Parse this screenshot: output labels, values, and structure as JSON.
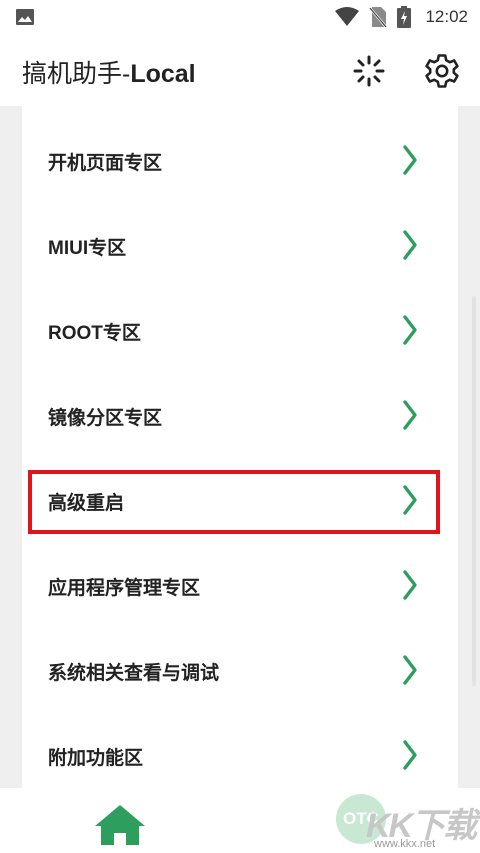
{
  "status_bar": {
    "time": "12:02",
    "icons": [
      "image-icon",
      "wifi-icon",
      "no-sim-icon",
      "battery-charging-icon"
    ]
  },
  "app_bar": {
    "title_cjk": "搞机助手-",
    "title_latin": "Local",
    "actions": [
      "loading-icon",
      "settings-icon"
    ]
  },
  "menu": {
    "items": [
      {
        "label": "开机页面专区"
      },
      {
        "label": "MIUI专区"
      },
      {
        "label": "ROOT专区"
      },
      {
        "label": "镜像分区专区"
      },
      {
        "label": "高级重启",
        "highlighted": true
      },
      {
        "label": "应用程序管理专区"
      },
      {
        "label": "系统相关查看与调试"
      },
      {
        "label": "附加功能区"
      }
    ],
    "chevron_icon": "chevron-right-icon"
  },
  "bottom_nav": {
    "home_icon": "home-icon"
  },
  "watermark": {
    "badge": "OTC",
    "logo": "KK下载",
    "url": "www.kkx.net"
  },
  "colors": {
    "accent_green": "#2e9e5e",
    "highlight_red": "#e0141a",
    "background": "#efefef",
    "card": "#ffffff"
  }
}
